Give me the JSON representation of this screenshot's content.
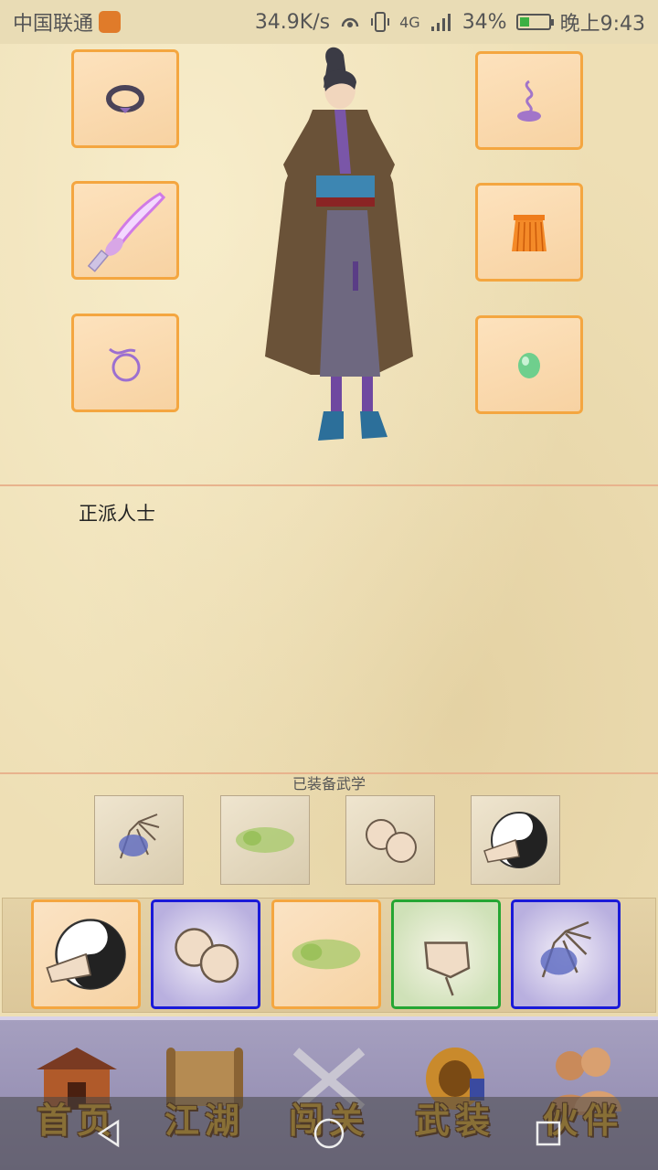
{
  "status_bar": {
    "carrier": "中国联通",
    "speed": "34.9K/s",
    "signal_label": "4G",
    "battery_percent": "34%",
    "battery_level": 0.34,
    "time": "晚上9:43"
  },
  "character": {
    "faction": "正派人士"
  },
  "equipment": {
    "left_slots": [
      "bracelet-icon",
      "saber-icon",
      "ring-icon"
    ],
    "right_slots": [
      "incense-icon",
      "skirt-icon",
      "jade-icon"
    ]
  },
  "skills": {
    "equipped_label": "已装备武学",
    "equipped": [
      "palm-skill",
      "poison-cloud-skill",
      "fist-pair-skill",
      "taiji-skill"
    ],
    "library": [
      {
        "name": "taiji-skill",
        "border": "orange"
      },
      {
        "name": "fist-pair-skill",
        "border": "blue"
      },
      {
        "name": "poison-cloud-skill",
        "border": "orange"
      },
      {
        "name": "fist-skill",
        "border": "green"
      },
      {
        "name": "palm-skill",
        "border": "blue"
      }
    ]
  },
  "nav": {
    "items": [
      {
        "label": "首页",
        "icon": "house-icon"
      },
      {
        "label": "江湖",
        "icon": "scroll-icon"
      },
      {
        "label": "闯关",
        "icon": "crossed-swords-icon"
      },
      {
        "label": "武装",
        "icon": "armor-icon"
      },
      {
        "label": "伙伴",
        "icon": "partners-icon"
      }
    ]
  },
  "colors": {
    "slot_border": "#f4a640",
    "blue_border": "#1a1ad8",
    "green_border": "#25a633",
    "nav_label": "#d9a325"
  }
}
